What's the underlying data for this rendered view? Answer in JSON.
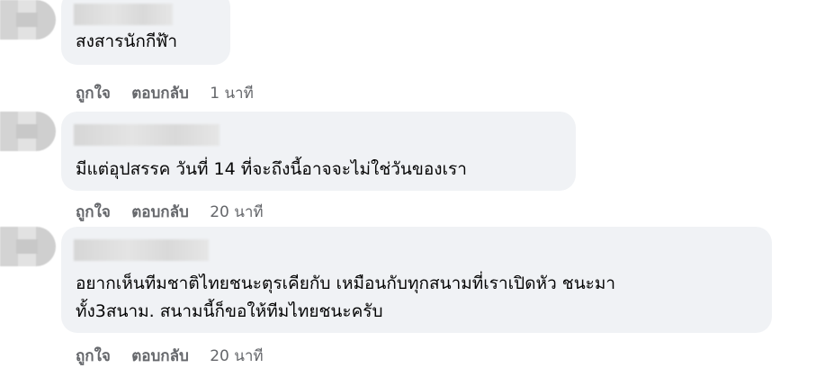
{
  "comments": [
    {
      "text_lines": [
        "สงสารนักกีฬ้า"
      ],
      "actions": {
        "like": "ถูกใจ",
        "reply": "ตอบกลับ",
        "time": "1 นาที"
      }
    },
    {
      "text_lines": [
        "มีแต่อุปสรรค วันที่ 14 ที่จะถึงนี้อาจจะไม่ใช่วันของเรา"
      ],
      "actions": {
        "like": "ถูกใจ",
        "reply": "ตอบกลับ",
        "time": "20 นาที"
      }
    },
    {
      "text_lines": [
        "อยากเห็นทีมชาติไทยชนะตุรเคียกับ เหมือนกับทุกสนามที่เราเปิดหัว ชนะมา",
        "ทั้ง3สนาม. สนามนี้ก็ขอให้ทีมไทยชนะครับ"
      ],
      "actions": {
        "like": "ถูกใจ",
        "reply": "ตอบกลับ",
        "time": "20 นาที"
      }
    }
  ],
  "colors": {
    "bubble": "#f0f2f5",
    "meta_text": "#65676b",
    "body_text": "#050505"
  }
}
